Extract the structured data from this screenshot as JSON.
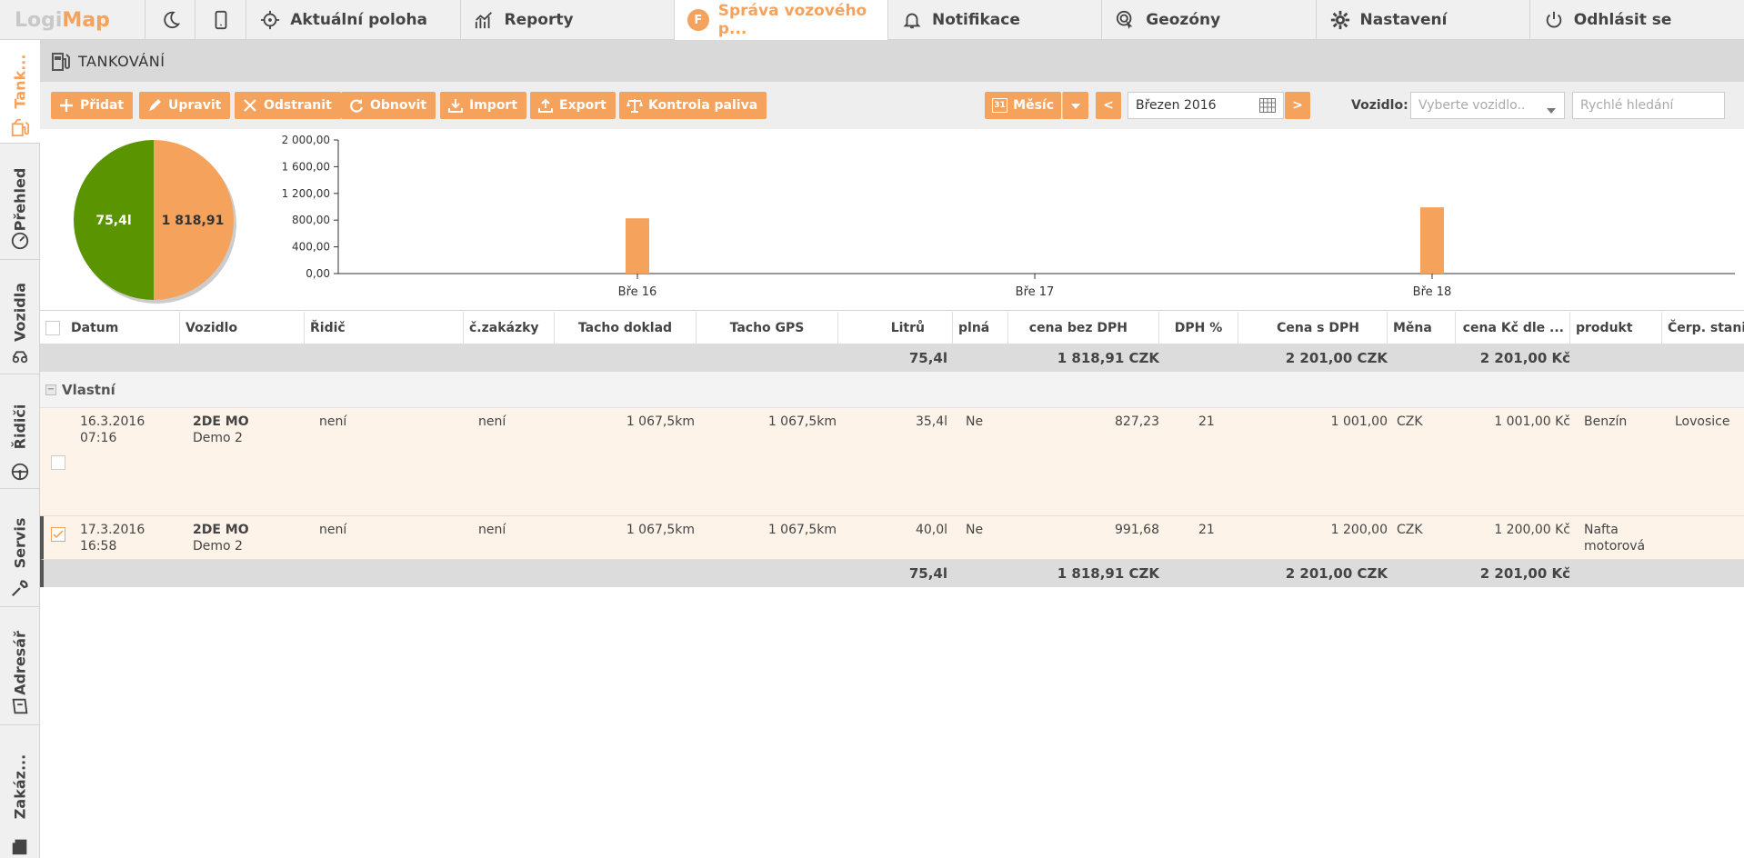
{
  "app": {
    "logo_part1": "Logi",
    "logo_part2": "Map"
  },
  "topnav": {
    "items": [
      {
        "label": "Aktuální poloha",
        "icon": "crosshair-icon"
      },
      {
        "label": "Reporty",
        "icon": "line-chart-icon"
      },
      {
        "label": "Správa vozového p...",
        "icon": "fleet-badge-icon",
        "badge": "F"
      },
      {
        "label": "Notifikace",
        "icon": "bell-icon"
      },
      {
        "label": "Geozóny",
        "icon": "geozone-icon"
      },
      {
        "label": "Nastavení",
        "icon": "gear-icon"
      },
      {
        "label": "Odhlásit se",
        "icon": "power-icon"
      }
    ]
  },
  "sidebar": {
    "items": [
      {
        "label": "Tank...",
        "icon": "fuel-icon"
      },
      {
        "label": "Přehled",
        "icon": "gauge-icon"
      },
      {
        "label": "Vozidla",
        "icon": "car-icon"
      },
      {
        "label": "Řidiči",
        "icon": "steering-wheel-icon"
      },
      {
        "label": "Servis",
        "icon": "wrench-icon"
      },
      {
        "label": "Adresář",
        "icon": "address-book-icon"
      },
      {
        "label": "Zakáz...",
        "icon": "order-icon"
      }
    ]
  },
  "page": {
    "title": "TANKOVÁNÍ"
  },
  "toolbar": {
    "add": "Přidat",
    "edit": "Upravit",
    "delete": "Odstranit",
    "refresh": "Obnovit",
    "import": "Import",
    "export": "Export",
    "fuel_check": "Kontrola paliva",
    "period": "Měsíc",
    "calendar_day": "31",
    "prev": "<",
    "next": ">",
    "month_value": "Březen 2016",
    "vehicle_label": "Vozidlo:",
    "vehicle_placeholder": "Vyberte vozidlo..",
    "search_placeholder": "Rychlé hledání"
  },
  "colors": {
    "accent": "#f5a25d",
    "green": "#5a9400",
    "row_bg": "#fdf3e8"
  },
  "chart_data": [
    {
      "type": "pie",
      "slices": [
        {
          "label": "75,4l",
          "value": 75.4,
          "color": "#5a9400"
        },
        {
          "label": "1 818,91",
          "value": 1818.91,
          "color": "#f5a25d"
        }
      ],
      "note": "two halves"
    },
    {
      "type": "bar",
      "categories": [
        "Bře 16",
        "Bře 17",
        "Bře 18"
      ],
      "values": [
        827.23,
        0,
        991.68
      ],
      "ylim": [
        0,
        2000
      ],
      "yticks": [
        "0,00",
        "400,00",
        "800,00",
        "1 200,00",
        "1 600,00",
        "2 000,00"
      ],
      "grid": false,
      "color": "#f5a25d"
    }
  ],
  "table": {
    "columns": [
      "Datum",
      "Vozidlo",
      "Řidič",
      "č.zakázky",
      "Tacho doklad",
      "Tacho GPS",
      "Litrů",
      "plná",
      "cena bez DPH",
      "DPH %",
      "Cena s DPH",
      "Měna",
      "cena Kč dle ...",
      "produkt",
      "Čerp. stanice"
    ],
    "summary": {
      "litry": "75,4l",
      "cena_bez_dph": "1 818,91 CZK",
      "cena_s_dph": "2 201,00 CZK",
      "cena_kc": "2 201,00 Kč"
    },
    "group": {
      "toggle": "−",
      "label": "Vlastní"
    },
    "rows": [
      {
        "date": "16.3.2016",
        "time": "07:16",
        "vehicle": "2DE MO",
        "vehicle_sub": "Demo 2",
        "driver": "není",
        "order": "není",
        "tacho_doklad": "1 067,5km",
        "tacho_gps": "1 067,5km",
        "litry": "35,4l",
        "plna": "Ne",
        "cena_bez_dph": "827,23",
        "dph": "21",
        "cena_s_dph": "1 001,00",
        "mena": "CZK",
        "cena_kc": "1 001,00 Kč",
        "produkt": "Benzín",
        "produkt2": "",
        "stanice": "Lovosice",
        "checked": false
      },
      {
        "date": "17.3.2016",
        "time": "16:58",
        "vehicle": "2DE MO",
        "vehicle_sub": "Demo 2",
        "driver": "není",
        "order": "není",
        "tacho_doklad": "1 067,5km",
        "tacho_gps": "1 067,5km",
        "litry": "40,0l",
        "plna": "Ne",
        "cena_bez_dph": "991,68",
        "dph": "21",
        "cena_s_dph": "1 200,00",
        "mena": "CZK",
        "cena_kc": "1 200,00 Kč",
        "produkt": "Nafta",
        "produkt2": "motorová",
        "stanice": "",
        "checked": true
      }
    ]
  }
}
